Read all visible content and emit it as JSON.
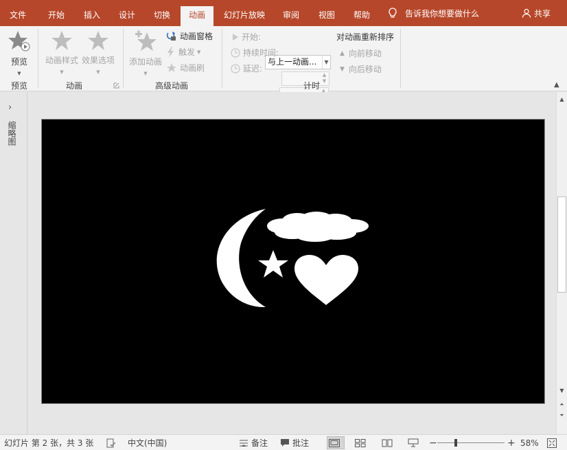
{
  "tabs": [
    "文件",
    "开始",
    "插入",
    "设计",
    "切换",
    "动画",
    "幻灯片放映",
    "审阅",
    "视图",
    "帮助"
  ],
  "active_tab": "动画",
  "tell_me": "告诉我你想要做什么",
  "share": "共享",
  "ribbon": {
    "preview": {
      "button": "预览",
      "group": "预览"
    },
    "animation": {
      "styles": "动画样式",
      "effects": "效果选项",
      "group": "动画"
    },
    "advanced": {
      "add": "添加动画",
      "pane": "动画窗格",
      "trigger": "触发",
      "painter": "动画刷",
      "group": "高级动画"
    },
    "timing": {
      "start_label": "开始:",
      "start_value": "与上一动画...",
      "duration_label": "持续时间:",
      "delay_label": "延迟:",
      "reorder": "对动画重新排序",
      "move_earlier": "向前移动",
      "move_later": "向后移动",
      "group": "计时"
    }
  },
  "left_panel": {
    "label": "缩略图"
  },
  "status": {
    "slide_info": "幻灯片 第 2 张，共 3 张",
    "language": "中文(中国)",
    "notes": "备注",
    "comments": "批注",
    "zoom": "58%"
  },
  "colors": {
    "accent": "#b7472a",
    "slide_bg": "#000000",
    "shapes": "#ffffff"
  }
}
